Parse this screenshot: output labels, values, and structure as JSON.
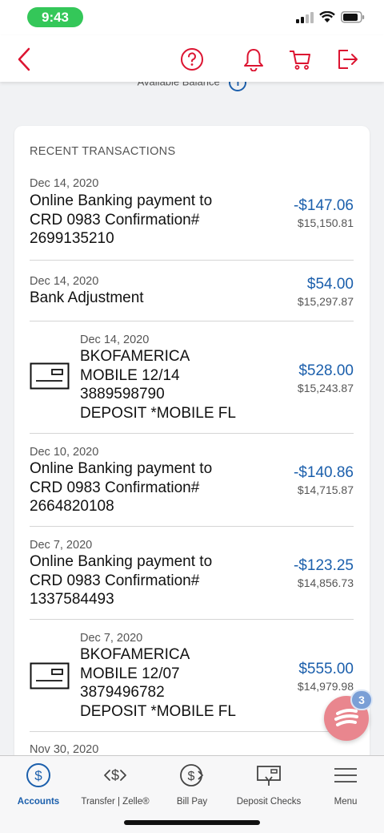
{
  "status_bar": {
    "time": "9:43"
  },
  "header": {
    "icons": [
      "back-icon",
      "help-icon",
      "bell-icon",
      "cart-icon",
      "logout-icon"
    ]
  },
  "balance_peek": {
    "label": "Available Balance",
    "info_glyph": "i"
  },
  "card": {
    "title": "RECENT TRANSACTIONS",
    "transactions": [
      {
        "date": "Dec 14, 2020",
        "desc_lines": [
          "Online Banking payment to",
          "CRD 0983 Confirmation#",
          "2699135210"
        ],
        "amount": "-$147.06",
        "balance": "$15,150.81",
        "is_check": false
      },
      {
        "date": "Dec 14, 2020",
        "desc_lines": [
          "Bank Adjustment"
        ],
        "amount": "$54.00",
        "balance": "$15,297.87",
        "is_check": false
      },
      {
        "date": "Dec 14, 2020",
        "desc_lines": [
          "BKOFAMERICA",
          "MOBILE 12/14",
          "3889598790",
          "DEPOSIT *MOBILE FL"
        ],
        "amount": "$528.00",
        "balance": "$15,243.87",
        "is_check": true
      },
      {
        "date": "Dec 10, 2020",
        "desc_lines": [
          "Online Banking payment to",
          "CRD 0983 Confirmation#",
          "2664820108"
        ],
        "amount": "-$140.86",
        "balance": "$14,715.87",
        "is_check": false
      },
      {
        "date": "Dec 7, 2020",
        "desc_lines": [
          "Online Banking payment to",
          "CRD 0983 Confirmation#",
          "1337584493"
        ],
        "amount": "-$123.25",
        "balance": "$14,856.73",
        "is_check": false
      },
      {
        "date": "Dec 7, 2020",
        "desc_lines": [
          "BKOFAMERICA",
          "MOBILE 12/07",
          "3879496782",
          "DEPOSIT *MOBILE FL"
        ],
        "amount": "$555.00",
        "balance": "$14,979.98",
        "is_check": true
      },
      {
        "date": "Nov 30, 2020",
        "desc_lines": [],
        "amount": "",
        "balance": "",
        "is_check": false
      }
    ]
  },
  "fab": {
    "badge": "3"
  },
  "bottom_nav": {
    "items": [
      {
        "label": "Accounts",
        "icon": "dollar-circle-icon",
        "active": true
      },
      {
        "label": "Transfer | Zelle®",
        "icon": "transfer-dollar-icon",
        "active": false
      },
      {
        "label": "Bill Pay",
        "icon": "bill-pay-icon",
        "active": false
      },
      {
        "label": "Deposit Checks",
        "icon": "deposit-check-icon",
        "active": false
      },
      {
        "label": "Menu",
        "icon": "menu-icon",
        "active": false
      }
    ]
  },
  "colors": {
    "brand_red": "#dc1431",
    "link_blue": "#1b5fac",
    "status_green": "#34c759"
  }
}
